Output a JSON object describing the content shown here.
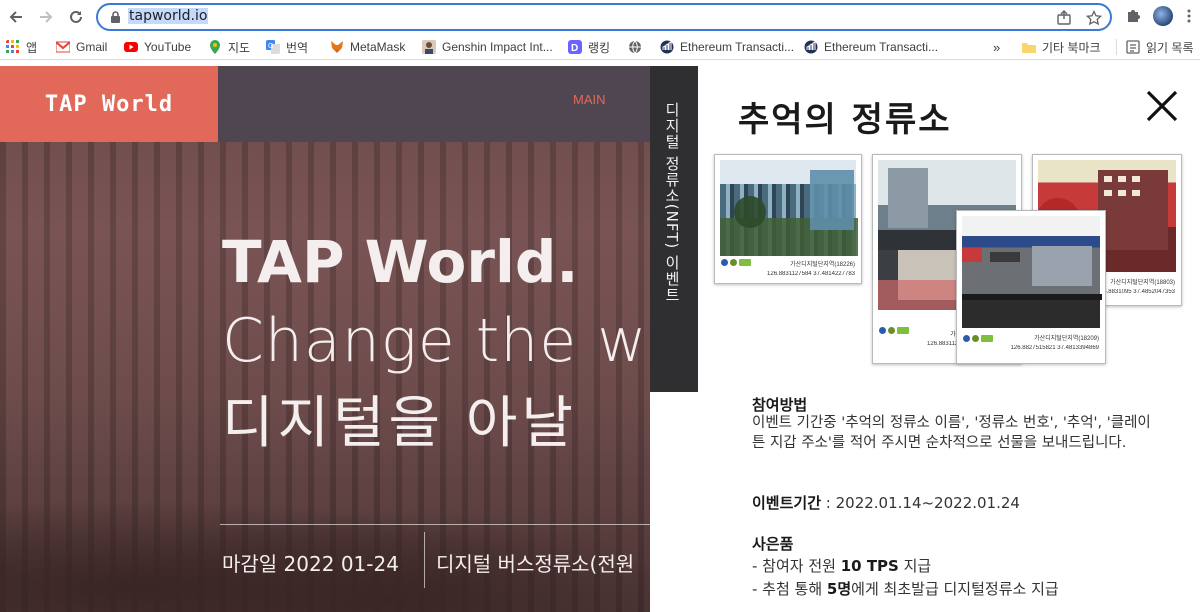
{
  "browser": {
    "url_host": "tapworld.io",
    "bookmarks": [
      {
        "label": "앱",
        "icon": "apps-grid-icon"
      },
      {
        "label": "Gmail",
        "icon": "gmail-icon"
      },
      {
        "label": "YouTube",
        "icon": "youtube-icon"
      },
      {
        "label": "지도",
        "icon": "maps-pin-icon"
      },
      {
        "label": "번역",
        "icon": "translate-icon"
      },
      {
        "label": "MetaMask",
        "icon": "metamask-fox-icon"
      },
      {
        "label": "Genshin Impact Int...",
        "icon": "genshin-avatar-icon"
      },
      {
        "label": "랭킹",
        "icon": "ranking-d-icon"
      },
      {
        "label": "",
        "icon": "globe-icon"
      },
      {
        "label": "Ethereum Transacti...",
        "icon": "etherscan-icon"
      },
      {
        "label": "Ethereum Transacti...",
        "icon": "etherscan-icon"
      }
    ],
    "overflow": "»",
    "other_bookmarks": "기타 북마크",
    "reading_list": "읽기 목록"
  },
  "site": {
    "logo": "TAP World",
    "menu_main": "MAIN",
    "hero_title": "TAP World.",
    "hero_line2": "Change the wo",
    "hero_line3": "디지털을 아날",
    "deadline": "마감일 2022 01-24",
    "subtitle": "디지털 버스정류소(전원"
  },
  "side_tab": {
    "label": "디지털 정류소(NFT) 이벤트"
  },
  "panel": {
    "title": "추억의 정류소",
    "photo_captions": [
      "가산디지털단지역(18226)",
      "가산디지털단지역(18834)",
      "가산디지털단지역(18209)",
      "가산디지털단지역(18803)"
    ],
    "photo_coords": [
      "126.8831127584   37.4814227783",
      "126.8831127584   37.4813259297",
      "126.8827515821   37.4813394869",
      "126.8831095   37.4852047353"
    ],
    "how_title": "참여방법",
    "how_body": "이벤트 기간중 '추억의 정류소 이름', '정류소 번호', '추억', '클레이튼 지갑 주소'를 적어 주시면 순차적으로 선물을 보내드립니다.",
    "period_label": "이벤트기간",
    "period_value": " : 2022.01.14~2022.01.24",
    "gift_title": "사은품",
    "gift_1_prefix": "- 참여자 전원 ",
    "gift_1_bold": "10 TPS",
    "gift_1_suffix": " 지급",
    "gift_2_prefix": "- 추첨 통해 ",
    "gift_2_bold": "5명",
    "gift_2_suffix": "에게 최초발급 디지털정류소 지급"
  },
  "colors": {
    "accent_coral": "#e2685a",
    "topbar": "#4f4651",
    "side_tab": "#2f2f31",
    "omnibox_focus": "#3c79d6"
  }
}
